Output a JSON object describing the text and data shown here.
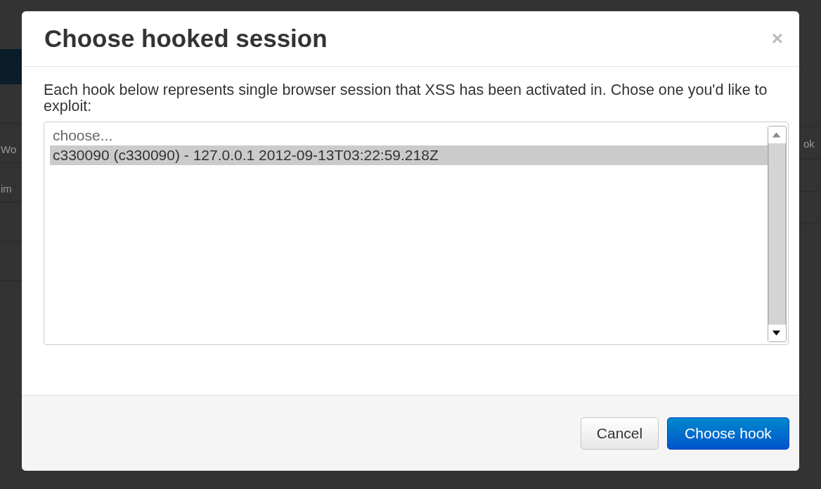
{
  "background": {
    "left_rows": [
      "Wo",
      "im"
    ],
    "right_rows": [
      "ok"
    ]
  },
  "dialog": {
    "title": "Choose hooked session",
    "close": "×",
    "message": "Each hook below represents single browser session that XSS has been activated in. Chose one you'd like to exploit:",
    "options": [
      {
        "label": "choose...",
        "kind": "placeholder",
        "selected": false
      },
      {
        "label": "c330090 (c330090) - 127.0.0.1 2012-09-13T03:22:59.218Z",
        "kind": "session",
        "selected": true
      }
    ],
    "buttons": [
      {
        "label": "Cancel",
        "kind": "default"
      },
      {
        "label": "Choose hook",
        "kind": "primary"
      }
    ]
  }
}
